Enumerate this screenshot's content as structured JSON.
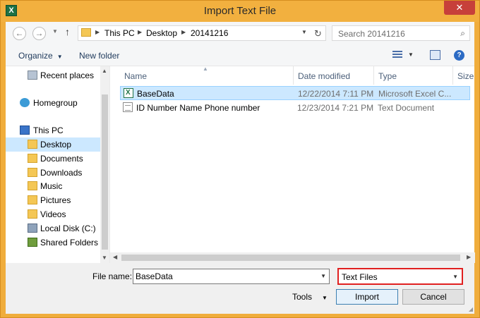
{
  "window": {
    "title": "Import Text File",
    "app_icon": "excel-icon",
    "close_glyph": "✕"
  },
  "nav": {
    "back_glyph": "←",
    "forward_glyph": "→",
    "up_glyph": "↑",
    "breadcrumbs": [
      "This PC",
      "Desktop",
      "20141216"
    ],
    "refresh_glyph": "↻",
    "search_placeholder": "Search 20141216",
    "search_glyph": "⌕"
  },
  "toolbar": {
    "organize": "Organize",
    "new_folder": "New folder",
    "help_glyph": "?"
  },
  "sidebar": {
    "items": [
      {
        "label": "Recent places",
        "icon": "recent-places-icon"
      },
      {
        "label": "Homegroup",
        "icon": "homegroup-icon"
      },
      {
        "label": "This PC",
        "icon": "computer-icon"
      },
      {
        "label": "Desktop",
        "icon": "folder-icon",
        "selected": true
      },
      {
        "label": "Documents",
        "icon": "folder-icon"
      },
      {
        "label": "Downloads",
        "icon": "folder-icon"
      },
      {
        "label": "Music",
        "icon": "folder-icon"
      },
      {
        "label": "Pictures",
        "icon": "folder-icon"
      },
      {
        "label": "Videos",
        "icon": "folder-icon"
      },
      {
        "label": "Local Disk (C:)",
        "icon": "disk-icon"
      },
      {
        "label": "Shared Folders (\\",
        "icon": "network-drive-icon"
      }
    ]
  },
  "filelist": {
    "columns": [
      "Name",
      "Date modified",
      "Type",
      "Size"
    ],
    "rows": [
      {
        "name": "BaseData",
        "date": "12/22/2014 7:11 PM",
        "type": "Microsoft Excel C...",
        "icon": "excel-file-icon",
        "selected": true
      },
      {
        "name": "ID Number Name Phone number",
        "date": "12/23/2014 7:21 PM",
        "type": "Text Document",
        "icon": "text-file-icon"
      }
    ]
  },
  "footer": {
    "file_name_label": "File name:",
    "file_name_value": "BaseData",
    "file_type_value": "Text Files",
    "tools": "Tools",
    "import": "Import",
    "cancel": "Cancel"
  },
  "colors": {
    "title_bar": "#f2b03f",
    "selection": "#cce8ff",
    "highlight_border": "#e02020"
  }
}
